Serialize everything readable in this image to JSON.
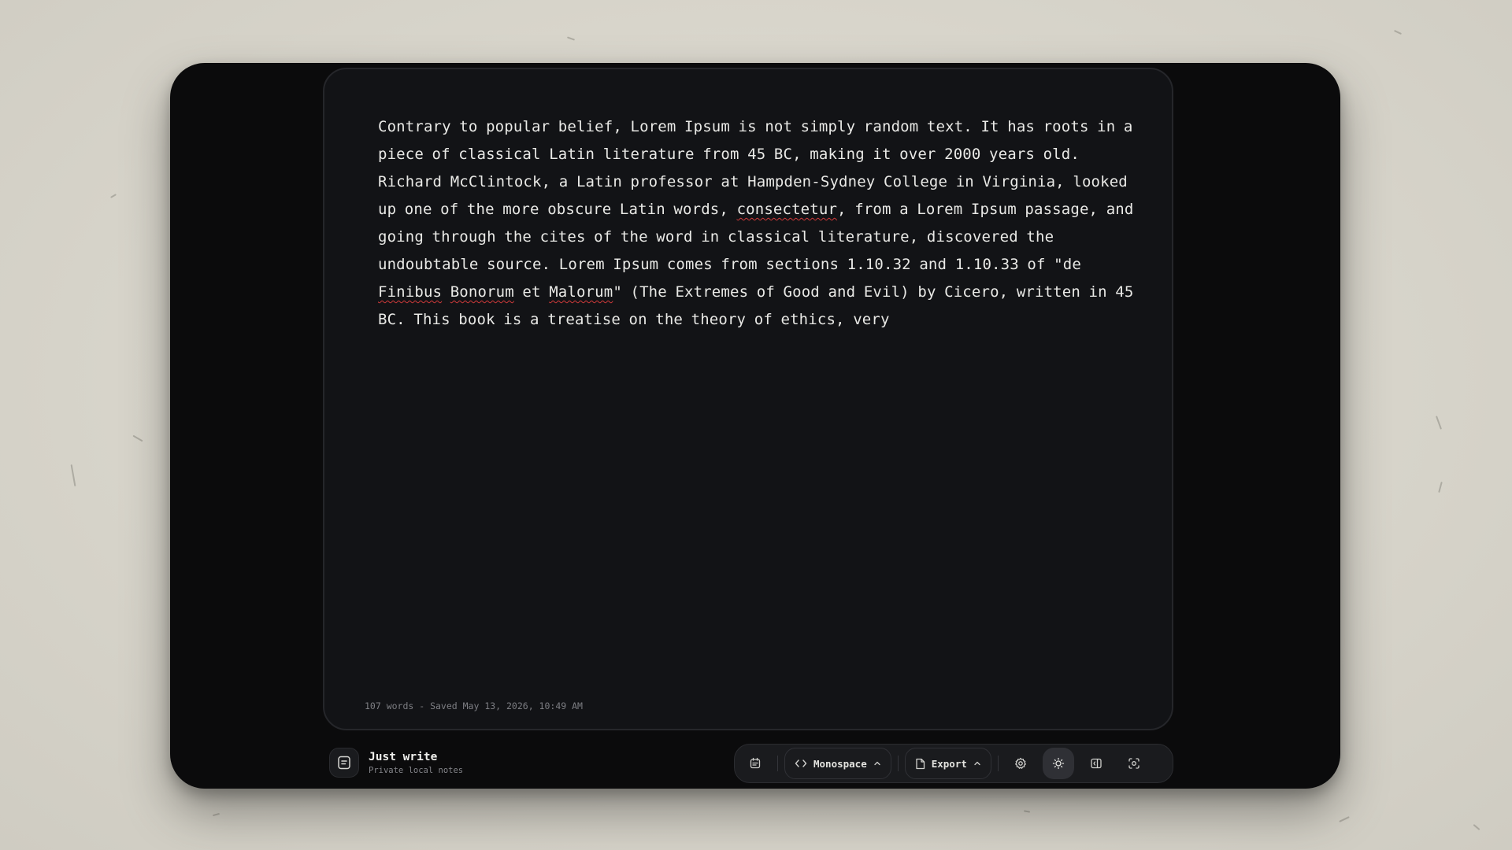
{
  "editor": {
    "segments": [
      {
        "text": "Contrary to popular belief, Lorem Ipsum is not simply random text. It has roots in a piece of classical Latin literature from 45 BC, making it over 2000 years old. Richard McClintock, a Latin professor at Hampden-Sydney College in Virginia, looked up one of the more obscure Latin words, ",
        "misspelled": false
      },
      {
        "text": "consectetur",
        "misspelled": true
      },
      {
        "text": ", from a Lorem Ipsum passage, and going through the cites of the word in classical literature, discovered the undoubtable source. Lorem Ipsum comes from sections 1.10.32 and 1.10.33 of \"de ",
        "misspelled": false
      },
      {
        "text": "Finibus",
        "misspelled": true
      },
      {
        "text": " ",
        "misspelled": false
      },
      {
        "text": "Bonorum",
        "misspelled": true
      },
      {
        "text": " et ",
        "misspelled": false
      },
      {
        "text": "Malorum",
        "misspelled": true
      },
      {
        "text": "\" (The Extremes of Good and Evil) by Cicero, written in 45 BC. This book is a treatise on the theory of ethics, very",
        "misspelled": false
      }
    ],
    "status": "107 words - Saved May 13, 2026, 10:49 AM"
  },
  "brand": {
    "title": "Just write",
    "subtitle": "Private local notes",
    "icon": "note-icon"
  },
  "toolbar": {
    "notes_icon": "notes-list-icon",
    "font_label": "Monospace",
    "font_icon": "code-icon",
    "export_label": "Export",
    "export_icon": "file-icon",
    "settings_icon": "gear-icon",
    "theme_icon": "sun-icon",
    "panel_icon": "panel-toggle-icon",
    "focus_icon": "focus-icon"
  },
  "colors": {
    "page_bg": "#dcd9cf",
    "window_bg": "#0b0b0c",
    "editor_bg": "#121316",
    "text": "#e9e9e6",
    "muted": "#7d7e83",
    "spell_error": "#d23a3a"
  }
}
